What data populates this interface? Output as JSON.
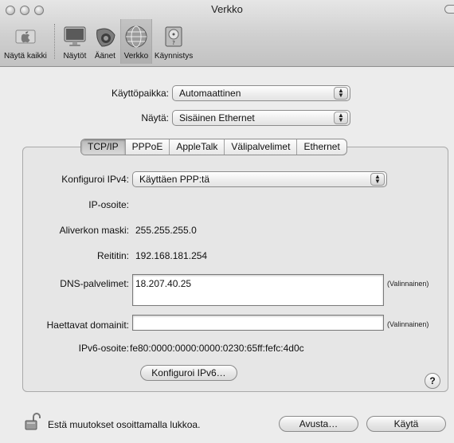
{
  "window": {
    "title": "Verkko"
  },
  "toolbar": {
    "items": [
      {
        "label": "Näytä kaikki",
        "icon": "show-all-icon"
      },
      {
        "label": "Näytöt",
        "icon": "displays-icon"
      },
      {
        "label": "Äänet",
        "icon": "sound-icon"
      },
      {
        "label": "Verkko",
        "icon": "network-icon",
        "active": true
      },
      {
        "label": "Käynnistys",
        "icon": "startup-disk-icon"
      }
    ]
  },
  "location": {
    "label": "Käyttöpaikka:",
    "value": "Automaattinen"
  },
  "show": {
    "label": "Näytä:",
    "value": "Sisäinen Ethernet"
  },
  "tabs": [
    "TCP/IP",
    "PPPoE",
    "AppleTalk",
    "Välipalvelimet",
    "Ethernet"
  ],
  "selected_tab": "TCP/IP",
  "tcpip": {
    "configure_label": "Konfiguroi IPv4:",
    "configure_value": "Käyttäen PPP:tä",
    "ip_label": "IP-osoite:",
    "ip_value": "",
    "subnet_label": "Aliverkon maski:",
    "subnet_value": "255.255.255.0",
    "router_label": "Reititin:",
    "router_value": "192.168.181.254",
    "dns_label": "DNS-palvelimet:",
    "dns_value": "18.207.40.25",
    "dns_hint": "(Valinnainen)",
    "search_label": "Haettavat domainit:",
    "search_value": "",
    "search_hint": "(Valinnainen)",
    "ipv6_label": "IPv6-osoite:",
    "ipv6_value": "fe80:0000:0000:0000:0230:65ff:fefc:4d0c",
    "configure_ipv6_button": "Konfiguroi IPv6…",
    "help_label": "?"
  },
  "footer": {
    "lock_text": "Estä muutokset osoittamalla lukkoa.",
    "assist_button": "Avusta…",
    "apply_button": "Käytä"
  },
  "colors": {
    "window_bg": "#ececec",
    "group_bg": "#e6e6e6"
  }
}
